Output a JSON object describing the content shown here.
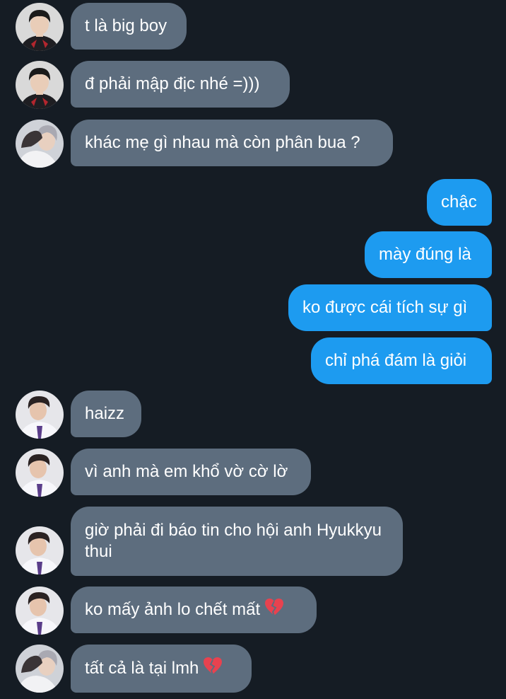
{
  "conversation": {
    "messages": [
      {
        "sender": "them",
        "avatar": "avatar-boy-dark-jacket",
        "text": "t là big boy"
      },
      {
        "sender": "them",
        "avatar": "avatar-boy-dark-jacket",
        "text": "đ phải mập địc nhé =)))"
      },
      {
        "sender": "them",
        "avatar": "avatar-gray-hair",
        "text": "khác mẹ gì nhau mà còn phân bua ?"
      },
      {
        "sender": "me",
        "text": "chậc"
      },
      {
        "sender": "me",
        "text": "mày đúng là"
      },
      {
        "sender": "me",
        "text": "ko được cái tích sự gì"
      },
      {
        "sender": "me",
        "text": "chỉ phá đám là giỏi"
      },
      {
        "sender": "them",
        "avatar": "avatar-boy-white-shirt",
        "text": "haizz"
      },
      {
        "sender": "them",
        "avatar": "avatar-boy-white-shirt",
        "text": "vì anh mà em khổ vờ cờ lờ"
      },
      {
        "sender": "them",
        "avatar": "avatar-boy-white-shirt",
        "text": "giờ phải đi báo tin cho hội anh Hyukkyu thui"
      },
      {
        "sender": "them",
        "avatar": "avatar-boy-white-shirt",
        "text": "ko mấy ảnh lo chết mất",
        "emoji": "broken-heart-icon"
      },
      {
        "sender": "them",
        "avatar": "avatar-gray-hair",
        "text": "tất cả là tại lmh",
        "emoji": "broken-heart-icon"
      }
    ]
  },
  "colors": {
    "background": "#151c24",
    "incoming_bubble": "#5d6d7e",
    "outgoing_bubble": "#1d9bf0",
    "text": "#ffffff",
    "heart": "#e8424f"
  }
}
